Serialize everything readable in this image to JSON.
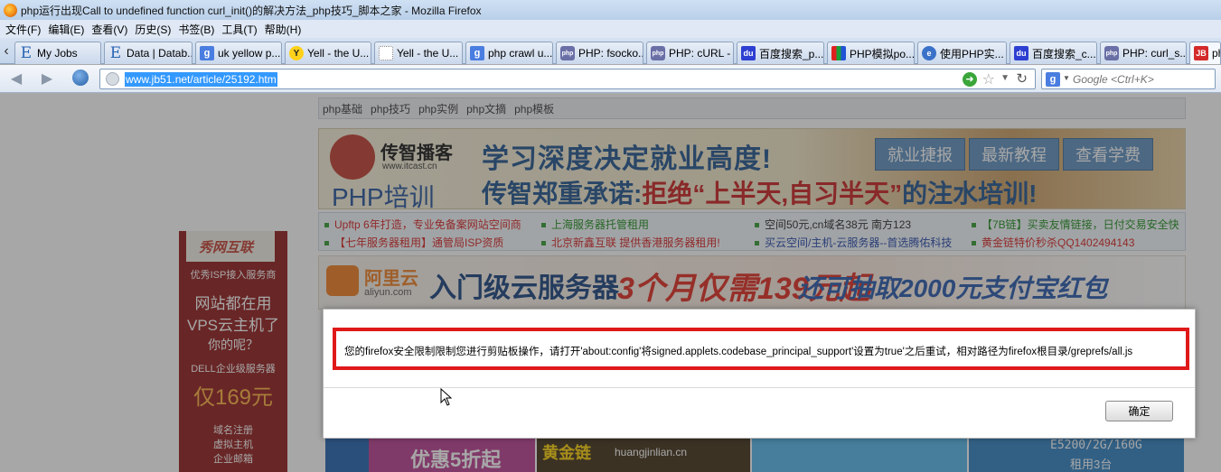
{
  "window": {
    "title": "php运行出现Call to undefined function curl_init()的解决方法_php技巧_脚本之家 - Mozilla Firefox"
  },
  "menu": [
    "文件(F)",
    "编辑(E)",
    "查看(V)",
    "历史(S)",
    "书签(B)",
    "工具(T)",
    "帮助(H)"
  ],
  "tabs": [
    {
      "label": "My Jobs",
      "icon": "E"
    },
    {
      "label": "Data | Datab...",
      "icon": "E"
    },
    {
      "label": "uk yellow p...",
      "icon": "g"
    },
    {
      "label": "Yell - the U...",
      "icon": "Y"
    },
    {
      "label": "Yell - the U...",
      "icon": ""
    },
    {
      "label": "php crawl u...",
      "icon": "g"
    },
    {
      "label": "PHP: fsocko...",
      "icon": "php"
    },
    {
      "label": "PHP: cURL - ...",
      "icon": "php"
    },
    {
      "label": "百度搜索_p...",
      "icon": "du"
    },
    {
      "label": "PHP模拟po...",
      "icon": ""
    },
    {
      "label": "使用PHP实...",
      "icon": "e"
    },
    {
      "label": "百度搜索_c...",
      "icon": "du"
    },
    {
      "label": "PHP: curl_s...",
      "icon": "php"
    },
    {
      "label": "ph",
      "icon": "JB"
    }
  ],
  "nav": {
    "url": "www.jb51.net/article/25192.htm",
    "search_placeholder": "Google <Ctrl+K>",
    "search_engine_icon": "g"
  },
  "page": {
    "subnav": [
      "php基础",
      "php技巧",
      "php实例",
      "php文摘",
      "php模板"
    ],
    "banner1": {
      "brand": "传智播客",
      "domain": "www.itcast.cn",
      "product": "PHP培训",
      "slogan1": "学习深度决定就业高度!",
      "slogan2_a": "传智郑重承诺:",
      "slogan2_b": "拒绝“上半天,自习半天”",
      "slogan2_c": "的注水培训!",
      "buttons": [
        "就业捷报",
        "最新教程",
        "查看学费"
      ]
    },
    "adlinks": [
      {
        "text": "Upftp 6年打造，专业免备案网站空间商",
        "color": "red"
      },
      {
        "text": "上海服务器托管租用",
        "color": "green"
      },
      {
        "text": "空间50元,cn域名38元 南方123",
        "color": "dark"
      },
      {
        "text": "【7B链】买卖友情链接，日付交易安全快",
        "color": "green"
      },
      {
        "text": "【七年服务器租用】通管局ISP资质",
        "color": "red"
      },
      {
        "text": "北京新鑫互联 提供香港服务器租用!",
        "color": "red"
      },
      {
        "text": "买云空间/主机-云服务器--首选腾佑科技",
        "color": "blue"
      },
      {
        "text": "黄金链特价秒杀QQ1402494143",
        "color": "red"
      }
    ],
    "banner2": {
      "brand": "阿里云",
      "domain": "aliyun.com",
      "text1": "入门级云服务器",
      "price": "3个月仅需139元起",
      "text2": "还可抽取2000元支付宝红包"
    },
    "side_ad": {
      "logo": "秀网互联",
      "lines": [
        "优秀ISP接入服务商",
        "网站都在用",
        "VPS云主机了",
        "你的呢？",
        "DELL企业级服务器",
        "仅169元",
        "域名注册",
        "虚拟主机",
        "企业邮箱"
      ]
    },
    "bottom_ads": [
      "优惠5折起",
      "黄金链",
      "huangjinlian.cn",
      "E5200/2G/160G",
      "租用3台"
    ]
  },
  "dialog": {
    "message": "您的firefox安全限制限制您进行剪贴板操作，请打开'about:config'将signed.applets.codebase_principal_support'设置为true'之后重试，相对路径为firefox根目录/greprefs/all.js",
    "ok_label": "确定"
  }
}
